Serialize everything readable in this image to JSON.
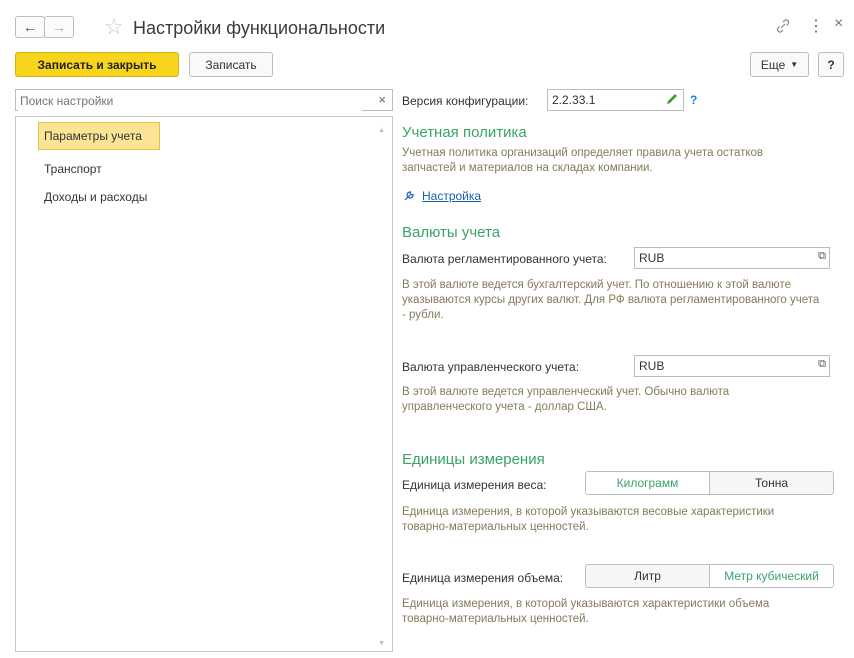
{
  "window": {
    "title": "Настройки функциональности",
    "back_icon": "←",
    "forward_icon": "→",
    "star_icon": "☆",
    "link_icon": "🔗",
    "menu_icon": "⋮",
    "close_icon": "×"
  },
  "toolbar": {
    "save_close_label": "Записать и закрыть",
    "save_label": "Записать",
    "more_label": "Еще",
    "help_label": "?"
  },
  "search": {
    "placeholder": "Поиск настройки",
    "clear_icon": "×"
  },
  "nav": {
    "items": [
      {
        "label": "Параметры учета",
        "selected": true
      },
      {
        "label": "Транспорт"
      },
      {
        "label": "Доходы и расходы"
      }
    ]
  },
  "config": {
    "label": "Версия конфигурации:",
    "value": "2.2.33.1",
    "help": "?"
  },
  "accounting_policy": {
    "title": "Учетная политика",
    "description": "Учетная политика организаций определяет правила учета остатков запчастей и материалов на складах компании.",
    "link": "Настройка"
  },
  "currencies": {
    "title": "Валюты учета",
    "reg_label": "Валюта регламентированного учета:",
    "reg_value": "RUB",
    "reg_desc": "В этой валюте ведется бухгалтерский учет. По отношению к этой валюте указываются курсы других валют. Для РФ валюта регламентированного учета - рубли.",
    "mgmt_label": "Валюта управленческого учета:",
    "mgmt_value": "RUB",
    "mgmt_desc": "В этой валюте ведется управленческий учет. Обычно валюта управленческого учета - доллар США."
  },
  "units": {
    "title": "Единицы измерения",
    "weight_label": "Единица измерения веса:",
    "weight_options": [
      "Килограмм",
      "Тонна"
    ],
    "weight_selected": "Килограмм",
    "weight_desc": "Единица измерения, в которой указываются весовые характеристики товарно-материальных ценностей.",
    "volume_label": "Единица измерения объема:",
    "volume_options": [
      "Литр",
      "Метр кубический"
    ],
    "volume_selected": "Метр кубический",
    "volume_desc": "Единица измерения, в которой указываются характеристики объема товарно-материальных ценностей."
  },
  "colors": {
    "accent_green": "#3aa36a",
    "primary_yellow": "#f7d51d",
    "desc_text": "#857a5a",
    "link_blue": "#1a5fb4"
  }
}
